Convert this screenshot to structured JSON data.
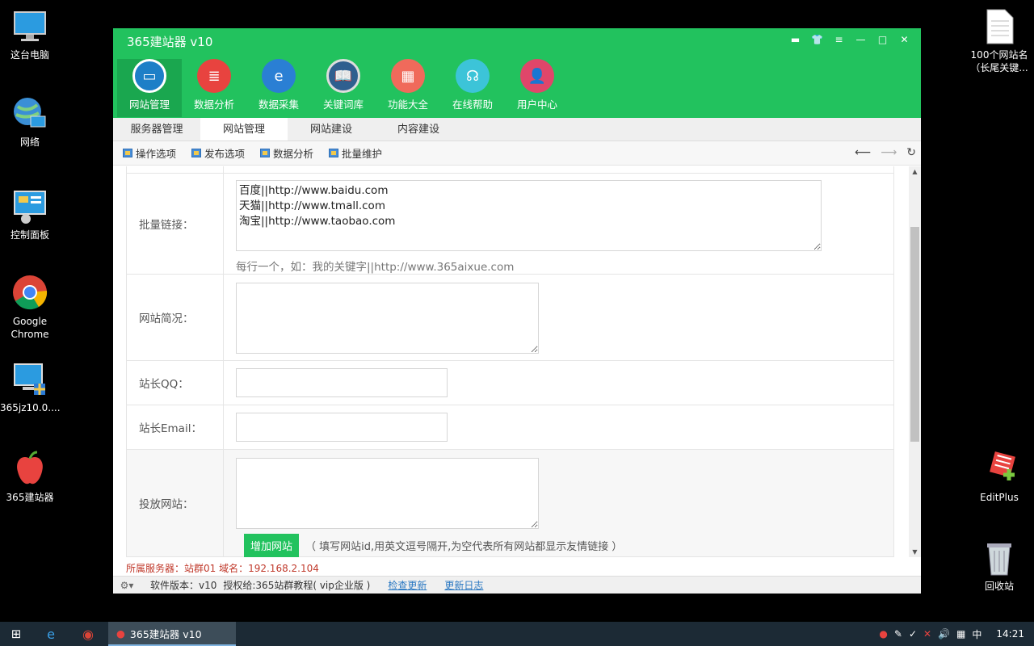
{
  "desktop": {
    "left_icons": [
      {
        "label": "这台电脑",
        "icon": "computer-icon"
      },
      {
        "label": "网络",
        "icon": "network-globe-icon"
      },
      {
        "label": "控制面板",
        "icon": "control-panel-icon"
      },
      {
        "label": "Google Chrome",
        "icon": "chrome-icon"
      },
      {
        "label": "365jz10.0....",
        "icon": "installer-icon"
      },
      {
        "label": "365建站器",
        "icon": "apple-icon"
      }
    ],
    "right_icons": [
      {
        "label": "100个网站名（长尾关键...",
        "icon": "document-icon"
      },
      {
        "label": "EditPlus",
        "icon": "editplus-icon"
      },
      {
        "label": "回收站",
        "icon": "recycle-bin-icon"
      }
    ]
  },
  "window": {
    "title": "365建站器 v10",
    "nav": [
      {
        "label": "网站管理",
        "icon": "monitor-icon",
        "color": "#1d7fc7"
      },
      {
        "label": "数据分析",
        "icon": "database-icon",
        "color": "#e8433f"
      },
      {
        "label": "数据采集",
        "icon": "edge-icon",
        "color": "#2a7fd4"
      },
      {
        "label": "关键词库",
        "icon": "book-icon",
        "color": "#2f5f8f"
      },
      {
        "label": "功能大全",
        "icon": "grid-icon",
        "color": "#f06a5b"
      },
      {
        "label": "在线帮助",
        "icon": "headset-icon",
        "color": "#3cc4d8"
      },
      {
        "label": "用户中心",
        "icon": "user-icon",
        "color": "#e0466a"
      }
    ],
    "tabs": [
      "服务器管理",
      "网站管理",
      "网站建设",
      "内容建设"
    ],
    "toolbar": [
      "操作选项",
      "发布选项",
      "数据分析",
      "批量维护"
    ],
    "form": {
      "batch_links_label": "批量链接：",
      "batch_links_value": "百度||http://www.baidu.com\n天猫||http://www.tmall.com\n淘宝||http://www.taobao.com",
      "batch_links_hint": "每行一个，如：我的关键字||http://www.365aixue.com",
      "site_desc_label": "网站简况：",
      "qq_label": "站长QQ：",
      "email_label": "站长Email：",
      "deploy_label": "投放网站：",
      "add_site_button": "增加网站",
      "add_site_hint": "（ 填写网站id,用英文逗号隔开,为空代表所有网站都显示友情链接 ）"
    },
    "server_line": "所属服务器：站群01  域名：192.168.2.104",
    "status": {
      "version": "软件版本：v10",
      "license": "授权给:365站群教程( vip企业版 )",
      "check_update": "检查更新",
      "changelog": "更新日志"
    }
  },
  "taskbar": {
    "app_label": "365建站器 v10",
    "ime": "中",
    "time": "14:21"
  }
}
